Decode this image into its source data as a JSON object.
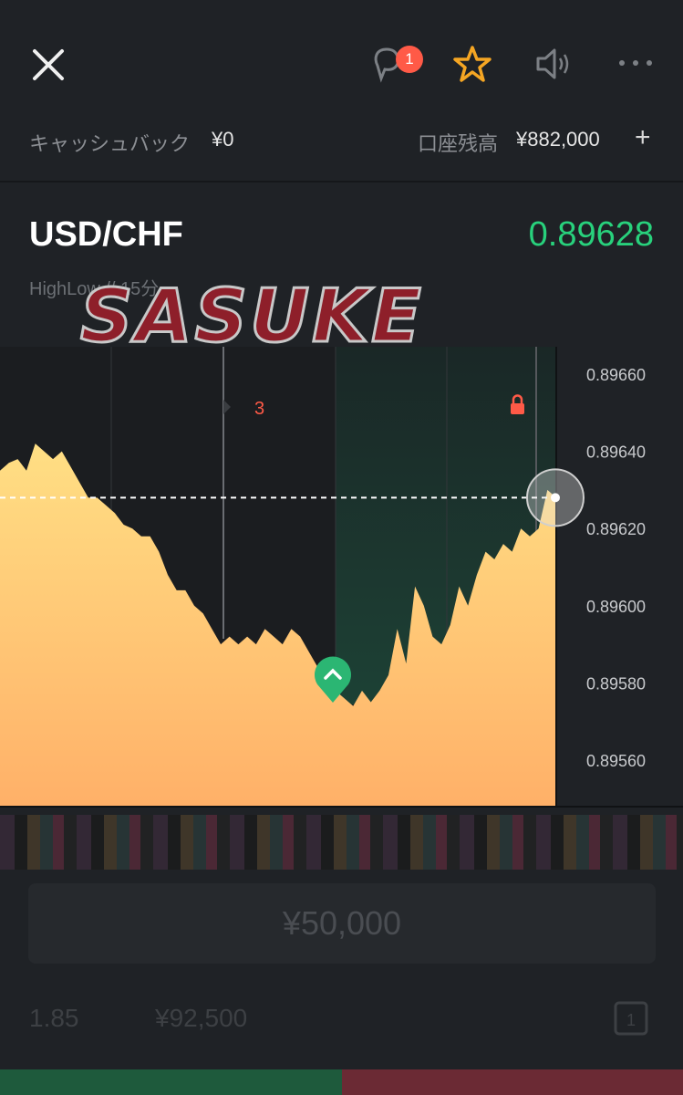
{
  "header": {
    "chat_badge": "1",
    "icons": [
      "close-icon",
      "chat-icon",
      "star-icon",
      "sound-icon",
      "more-icon"
    ],
    "star_color": "#f5a623"
  },
  "account": {
    "cashback_label": "キャッシュバック",
    "cashback_value": "¥0",
    "balance_label": "口座残高",
    "balance_value": "¥882,000",
    "add_label": "+"
  },
  "asset": {
    "pair": "USD/CHF",
    "price": "0.89628",
    "price_color": "#28d17c",
    "subtitle": "HighLow  //  15分",
    "watermark": "SASUKE"
  },
  "chart": {
    "y_labels": [
      "0.89660",
      "0.89640",
      "0.89620",
      "0.89600",
      "0.89580",
      "0.89560"
    ],
    "countdown": "3",
    "current_price": 0.89628,
    "entry_price": 0.89575,
    "series": [
      0.89635,
      0.89637,
      0.89638,
      0.89635,
      0.89642,
      0.8964,
      0.89638,
      0.8964,
      0.89636,
      0.89632,
      0.89628,
      0.89628,
      0.89626,
      0.89624,
      0.89621,
      0.8962,
      0.89618,
      0.89618,
      0.89614,
      0.89608,
      0.89604,
      0.89604,
      0.896,
      0.89598,
      0.89594,
      0.8959,
      0.89592,
      0.8959,
      0.89592,
      0.8959,
      0.89594,
      0.89592,
      0.8959,
      0.89594,
      0.89592,
      0.89588,
      0.89584,
      0.89582,
      0.89578,
      0.89576,
      0.89574,
      0.89578,
      0.89575,
      0.89578,
      0.89582,
      0.89594,
      0.89585,
      0.89605,
      0.896,
      0.89592,
      0.8959,
      0.89595,
      0.89605,
      0.896,
      0.89608,
      0.89614,
      0.89612,
      0.89616,
      0.89614,
      0.8962,
      0.89618,
      0.8962,
      0.8963,
      0.89628
    ]
  },
  "trade": {
    "amount": "¥50,000",
    "payout_rate": "1.85",
    "payout_amount": "¥92,500"
  },
  "colors": {
    "up": "#1e5a3c",
    "down": "#6b2a34",
    "area_top": "#ffd77a",
    "area_bottom": "#ffb36a"
  }
}
